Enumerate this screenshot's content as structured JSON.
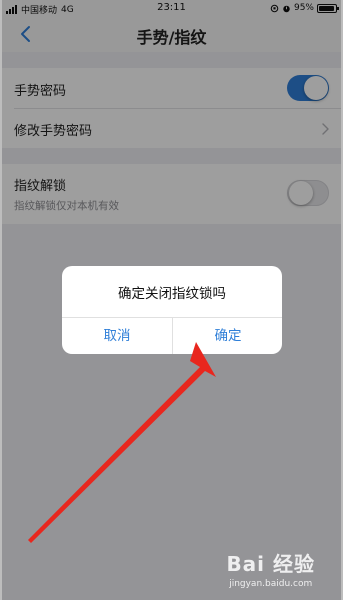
{
  "status_bar": {
    "carrier": "中国移动",
    "network": "4G",
    "time": "23:11",
    "battery": "95%",
    "battery_level": 0.95
  },
  "nav": {
    "title": "手势/指纹",
    "back_icon": "chevron-left-icon"
  },
  "settings": {
    "gesture_password": {
      "label": "手势密码",
      "enabled": true
    },
    "change_gesture_password": {
      "label": "修改手势密码"
    },
    "fingerprint_unlock": {
      "label": "指纹解锁",
      "subtitle": "指纹解锁仅对本机有效",
      "enabled": false
    }
  },
  "dialog": {
    "message": "确定关闭指纹锁吗",
    "cancel_label": "取消",
    "confirm_label": "确定"
  },
  "colors": {
    "accent": "#2f7fd8",
    "annotation_arrow": "#e8271e"
  },
  "watermark": {
    "logo": "Bai 经验",
    "url": "jingyan.baidu.com"
  }
}
